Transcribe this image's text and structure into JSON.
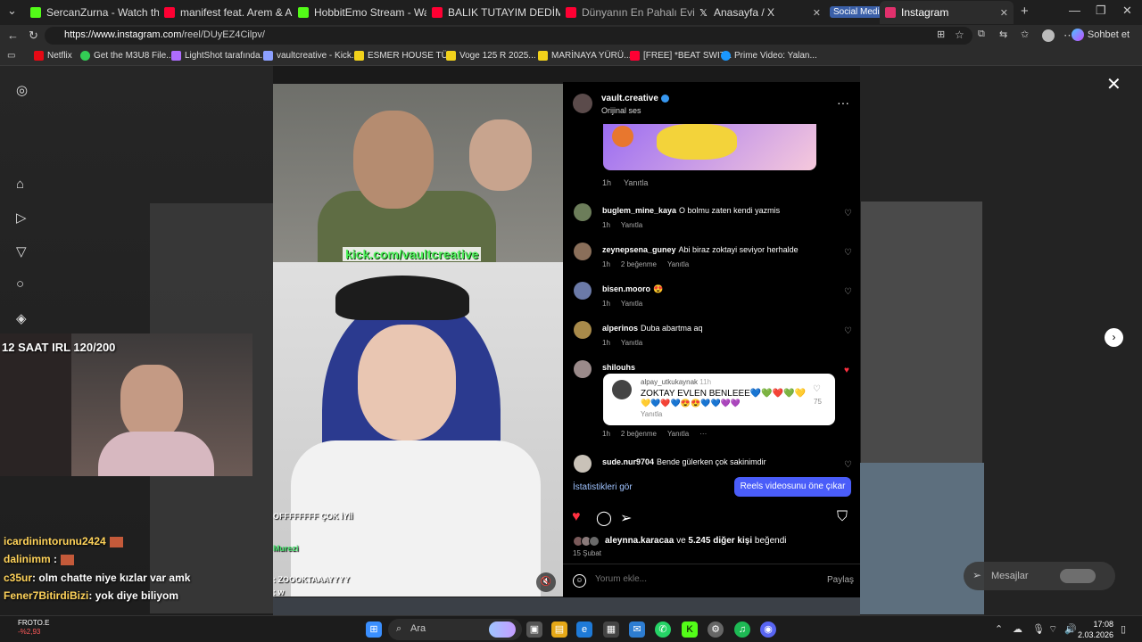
{
  "browser": {
    "tabs": [
      {
        "title": "SercanZurna - Watch the VOD o",
        "color": "#53fc18"
      },
      {
        "title": "manifest feat. Arem & Arman -",
        "color": "#ff0033"
      },
      {
        "title": "HobbitEmo Stream - Watch Live",
        "color": "#53fc18"
      },
      {
        "title": "BALIK TUTAYIM DEDİM BALIĞI T",
        "color": "#ff0033"
      },
      {
        "title": "Dünyanın En Pahalı Evi / New Y",
        "color": "#ff0033"
      },
      {
        "title": "Anasayfa / X",
        "color": "#ffffff"
      },
      {
        "title": "Instagram",
        "color": "#e1306c"
      }
    ],
    "group_label": "Social Media",
    "url_host": "https://www.instagram.com",
    "url_path": "/reel/DUyEZ4Cilpv/",
    "chat_label": "Sohbet et",
    "bookmarks": [
      "Netflix",
      "Get the M3U8 File...",
      "LightShot tarafında...",
      "vaultcreative - Kick...",
      "ESMER HOUSE TÜ...",
      "Voge 125 R 2025...",
      "MARİNAYA YÜRÜ...",
      "[FREE] *BEAT SWIT...",
      "Prime Video: Yalan..."
    ]
  },
  "stream": {
    "title": "12 SAAT IRL 120/200",
    "chat": [
      {
        "user": "icardinintorunu2424",
        "text": ""
      },
      {
        "user": "dalinimm",
        "text": ""
      },
      {
        "user": "c35ur",
        "text": ": olm chatte niye kızlar var amk"
      },
      {
        "user": "Fener7BitirdiBizi",
        "text": ": yok diye biliyom"
      },
      {
        "user": "",
        "text": ""
      }
    ]
  },
  "video": {
    "banner": "kick.com/vaultcreative",
    "chat": [
      {
        "user": "Murezi",
        "text": ""
      },
      {
        "user": "",
        "text": "OFFFFFFFF ÇOK İYİİ"
      },
      {
        "user": "",
        "text": ": ZOOOKTAAAYYYY"
      },
      {
        "user": "",
        "text": ": w"
      }
    ]
  },
  "reel": {
    "author": "vault.creative",
    "audio": "Orijinal ses",
    "top_meta": {
      "time": "1h",
      "reply": "Yanıtla"
    },
    "comments": [
      {
        "user": "buglem_mine_kaya",
        "text": "O bolmu zaten kendi yazmis",
        "time": "1h",
        "likes": "",
        "reply": "Yanıtla"
      },
      {
        "user": "zeynepsena_guney",
        "text": "Abi biraz zoktayi seviyor herhalde",
        "time": "1h",
        "likes": "2 beğenme",
        "reply": "Yanıtla"
      },
      {
        "user": "bisen.mooro",
        "text": "😍",
        "time": "1h",
        "likes": "",
        "reply": "Yanıtla"
      },
      {
        "user": "alperinos",
        "text": "Duba abartma aq",
        "time": "1h",
        "likes": "",
        "reply": "Yanıtla"
      },
      {
        "user": "shilouhs",
        "text": "",
        "time": "1h",
        "likes": "2 beğenme",
        "reply": "Yanıtla"
      },
      {
        "user": "sude.nur9704",
        "text": "Bende gülerken çok sakinimdir",
        "time": "",
        "likes": "",
        "reply": ""
      }
    ],
    "reply_card": {
      "user": "alpay_utkukaynak",
      "time": "11h",
      "text": "ZOKTAY EVLEN BENLEEE💙💚❤️💚💛",
      "emojis": "💛💙❤️💙😍😍💙💙💜💜",
      "reply": "Yanıtla",
      "likes": "75"
    },
    "stats_label": "İstatistikleri gör",
    "promote_label": "Reels videosunu öne çıkar",
    "liked_by": "aleynna.karacaa",
    "likes_rest": "ve",
    "likes_count": "5.245 diğer kişi",
    "likes_suffix": "beğendi",
    "date": "15 Şubat",
    "comment_placeholder": "Yorum ekle...",
    "share_label": "Paylaş",
    "messages_label": "Mesajlar"
  },
  "taskbar": {
    "search_label": "Ara",
    "time": "17:08",
    "date": "2.03.2026",
    "froto_name": "FROTO.E",
    "froto_change": "-%2,93"
  }
}
